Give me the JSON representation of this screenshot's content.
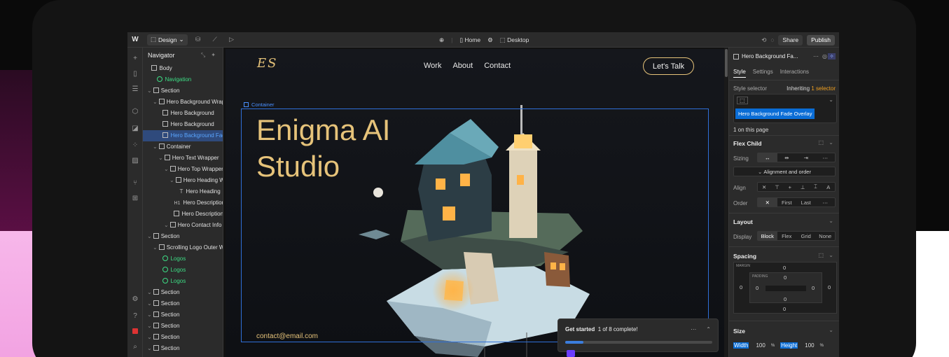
{
  "topbar": {
    "mode_label": "Design",
    "page_name": "Home",
    "breakpoint": "Desktop",
    "share_label": "Share",
    "publish_label": "Publish"
  },
  "navigator": {
    "title": "Navigator",
    "items": [
      {
        "label": "Body",
        "indent": 0,
        "type": "box",
        "caret": false
      },
      {
        "label": "Navigation",
        "indent": 1,
        "type": "component",
        "caret": false
      },
      {
        "label": "Section",
        "indent": 0,
        "type": "box",
        "caret": true
      },
      {
        "label": "Hero Background Wrapper",
        "indent": 1,
        "type": "box",
        "caret": true
      },
      {
        "label": "Hero Background",
        "indent": 2,
        "type": "image",
        "caret": false
      },
      {
        "label": "Hero Background",
        "indent": 2,
        "type": "image",
        "caret": false
      },
      {
        "label": "Hero Background Fade Overlay",
        "indent": 2,
        "type": "box",
        "caret": false,
        "selected": true
      },
      {
        "label": "Container",
        "indent": 1,
        "type": "box",
        "caret": true
      },
      {
        "label": "Hero Text Wrapper",
        "indent": 2,
        "type": "box",
        "caret": true
      },
      {
        "label": "Hero Top Wrapper",
        "indent": 3,
        "type": "box",
        "caret": true
      },
      {
        "label": "Hero Heading Wrapper",
        "indent": 4,
        "type": "box",
        "caret": true
      },
      {
        "label": "Hero Heading",
        "indent": 5,
        "type": "text",
        "caret": false
      },
      {
        "label": "Hero Description",
        "indent": 4,
        "type": "h1",
        "caret": false
      },
      {
        "label": "Hero Description",
        "indent": 4,
        "type": "box",
        "caret": false
      },
      {
        "label": "Hero Contact Info",
        "indent": 3,
        "type": "box",
        "caret": true
      },
      {
        "label": "Section",
        "indent": 0,
        "type": "box",
        "caret": true
      },
      {
        "label": "Scrolling Logo Outer Wrapper",
        "indent": 1,
        "type": "box",
        "caret": true
      },
      {
        "label": "Logos",
        "indent": 2,
        "type": "component",
        "caret": false
      },
      {
        "label": "Logos",
        "indent": 2,
        "type": "component",
        "caret": false
      },
      {
        "label": "Logos",
        "indent": 2,
        "type": "component",
        "caret": false
      },
      {
        "label": "Section",
        "indent": 0,
        "type": "box",
        "caret": true
      },
      {
        "label": "Section",
        "indent": 0,
        "type": "box",
        "caret": true
      },
      {
        "label": "Section",
        "indent": 0,
        "type": "box",
        "caret": true
      },
      {
        "label": "Section",
        "indent": 0,
        "type": "box",
        "caret": true
      },
      {
        "label": "Section",
        "indent": 0,
        "type": "box",
        "caret": true
      },
      {
        "label": "Section",
        "indent": 0,
        "type": "box",
        "caret": true
      }
    ]
  },
  "site": {
    "logo": "ES",
    "nav": [
      "Work",
      "About",
      "Contact"
    ],
    "cta": "Let's Talk",
    "container_label": "Container",
    "hero_line1": "Enigma AI",
    "hero_line2": "Studio",
    "contact": "contact@email.com"
  },
  "getting_started": {
    "title": "Get started",
    "progress_text": "1 of 8 complete!",
    "progress": 0.125
  },
  "right_panel": {
    "element_name": "Hero Background Fa...",
    "tabs": [
      "Style",
      "Settings",
      "Interactions"
    ],
    "style_selector_label": "Style selector",
    "inheriting_label": "Inheriting",
    "inheriting_link": "1 selector",
    "selector_chip": "Hero Background Fade Overlay",
    "on_page": "1 on this page",
    "flex_child_title": "Flex Child",
    "sizing_label": "Sizing",
    "alignment_label": "Alignment and order",
    "align_label": "Align",
    "order_label": "Order",
    "order_options": [
      "First",
      "Last"
    ],
    "layout_title": "Layout",
    "display_label": "Display",
    "display_options": [
      "Block",
      "Flex",
      "Grid",
      "None"
    ],
    "spacing_title": "Spacing",
    "margin_label": "MARGIN",
    "padding_label": "PADDING",
    "margin_top": "0",
    "margin_bottom": "0",
    "margin_left": "0",
    "margin_right": "0",
    "padding_top": "0",
    "padding_bottom": "0",
    "padding_left": "0",
    "padding_right": "0",
    "size_title": "Size",
    "width_label": "Width",
    "width_value": "100",
    "width_unit": "%",
    "height_label": "Height",
    "height_value": "100",
    "height_unit": "%"
  },
  "colors": {
    "accent_gold": "#e6c37a",
    "selection_blue": "#0a6dd6",
    "component_green": "#3ddc84",
    "inheriting_orange": "#f0a020"
  }
}
